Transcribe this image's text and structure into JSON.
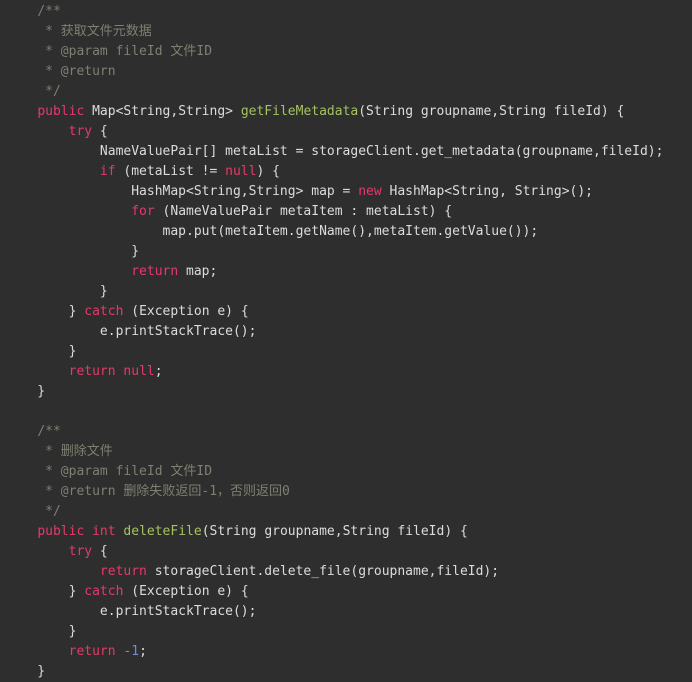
{
  "editor": {
    "background_color": "#2e2e2e",
    "default_text_color": "#dcdcdc",
    "keyword_color": "#e5396b",
    "method_color": "#a5c261",
    "comment_color": "#7f7f72",
    "number_color": "#6c8fd4",
    "language": "Java",
    "font_size_px": 13,
    "line_height_px": 20,
    "indent_spaces": 4
  },
  "code": {
    "lines": [
      {
        "index": 1,
        "tokens": [
          {
            "text": "    ",
            "type": "plain"
          },
          {
            "text": "/**",
            "type": "comment"
          }
        ]
      },
      {
        "index": 2,
        "tokens": [
          {
            "text": "     ",
            "type": "plain"
          },
          {
            "text": "* 获取文件元数据",
            "type": "comment"
          }
        ]
      },
      {
        "index": 3,
        "tokens": [
          {
            "text": "     ",
            "type": "plain"
          },
          {
            "text": "* @param fileId 文件ID",
            "type": "comment"
          }
        ]
      },
      {
        "index": 4,
        "tokens": [
          {
            "text": "     ",
            "type": "plain"
          },
          {
            "text": "* @return",
            "type": "comment"
          }
        ]
      },
      {
        "index": 5,
        "tokens": [
          {
            "text": "     ",
            "type": "plain"
          },
          {
            "text": "*/",
            "type": "comment"
          }
        ]
      },
      {
        "index": 6,
        "tokens": [
          {
            "text": "    ",
            "type": "plain"
          },
          {
            "text": "public",
            "type": "keyword"
          },
          {
            "text": " Map<String,String> ",
            "type": "plain"
          },
          {
            "text": "getFileMetadata",
            "type": "method"
          },
          {
            "text": "(String groupname,String fileId) {",
            "type": "plain"
          }
        ]
      },
      {
        "index": 7,
        "tokens": [
          {
            "text": "        ",
            "type": "plain"
          },
          {
            "text": "try",
            "type": "keyword"
          },
          {
            "text": " {",
            "type": "plain"
          }
        ]
      },
      {
        "index": 8,
        "tokens": [
          {
            "text": "            NameValuePair[] metaList = storageClient.get_metadata(groupname,fileId);",
            "type": "plain"
          }
        ]
      },
      {
        "index": 9,
        "tokens": [
          {
            "text": "            ",
            "type": "plain"
          },
          {
            "text": "if",
            "type": "keyword"
          },
          {
            "text": " (metaList != ",
            "type": "plain"
          },
          {
            "text": "null",
            "type": "keyword"
          },
          {
            "text": ") {",
            "type": "plain"
          }
        ]
      },
      {
        "index": 10,
        "tokens": [
          {
            "text": "                HashMap<String,String> map = ",
            "type": "plain"
          },
          {
            "text": "new",
            "type": "keyword"
          },
          {
            "text": " HashMap<String, String>();",
            "type": "plain"
          }
        ]
      },
      {
        "index": 11,
        "tokens": [
          {
            "text": "                ",
            "type": "plain"
          },
          {
            "text": "for",
            "type": "keyword"
          },
          {
            "text": " (NameValuePair metaItem : metaList) {",
            "type": "plain"
          }
        ]
      },
      {
        "index": 12,
        "tokens": [
          {
            "text": "                    map.put(metaItem.getName(),metaItem.getValue());",
            "type": "plain"
          }
        ]
      },
      {
        "index": 13,
        "tokens": [
          {
            "text": "                }",
            "type": "plain"
          }
        ]
      },
      {
        "index": 14,
        "tokens": [
          {
            "text": "                ",
            "type": "plain"
          },
          {
            "text": "return",
            "type": "keyword"
          },
          {
            "text": " map;",
            "type": "plain"
          }
        ]
      },
      {
        "index": 15,
        "tokens": [
          {
            "text": "            }",
            "type": "plain"
          }
        ]
      },
      {
        "index": 16,
        "tokens": [
          {
            "text": "        } ",
            "type": "plain"
          },
          {
            "text": "catch",
            "type": "keyword"
          },
          {
            "text": " (Exception e) {",
            "type": "plain"
          }
        ]
      },
      {
        "index": 17,
        "tokens": [
          {
            "text": "            e.printStackTrace();",
            "type": "plain"
          }
        ]
      },
      {
        "index": 18,
        "tokens": [
          {
            "text": "        }",
            "type": "plain"
          }
        ]
      },
      {
        "index": 19,
        "tokens": [
          {
            "text": "        ",
            "type": "plain"
          },
          {
            "text": "return",
            "type": "keyword"
          },
          {
            "text": " ",
            "type": "plain"
          },
          {
            "text": "null",
            "type": "keyword"
          },
          {
            "text": ";",
            "type": "plain"
          }
        ]
      },
      {
        "index": 20,
        "tokens": [
          {
            "text": "    }",
            "type": "plain"
          }
        ]
      },
      {
        "index": 21,
        "tokens": []
      },
      {
        "index": 22,
        "tokens": [
          {
            "text": "    ",
            "type": "plain"
          },
          {
            "text": "/**",
            "type": "comment"
          }
        ]
      },
      {
        "index": 23,
        "tokens": [
          {
            "text": "     ",
            "type": "plain"
          },
          {
            "text": "* 删除文件",
            "type": "comment"
          }
        ]
      },
      {
        "index": 24,
        "tokens": [
          {
            "text": "     ",
            "type": "plain"
          },
          {
            "text": "* @param fileId 文件ID",
            "type": "comment"
          }
        ]
      },
      {
        "index": 25,
        "tokens": [
          {
            "text": "     ",
            "type": "plain"
          },
          {
            "text": "* @return 删除失败返回-1，否则返回0",
            "type": "comment"
          }
        ]
      },
      {
        "index": 26,
        "tokens": [
          {
            "text": "     ",
            "type": "plain"
          },
          {
            "text": "*/",
            "type": "comment"
          }
        ]
      },
      {
        "index": 27,
        "tokens": [
          {
            "text": "    ",
            "type": "plain"
          },
          {
            "text": "public",
            "type": "keyword"
          },
          {
            "text": " ",
            "type": "plain"
          },
          {
            "text": "int",
            "type": "keyword"
          },
          {
            "text": " ",
            "type": "plain"
          },
          {
            "text": "deleteFile",
            "type": "method"
          },
          {
            "text": "(String groupname,String fileId) {",
            "type": "plain"
          }
        ]
      },
      {
        "index": 28,
        "tokens": [
          {
            "text": "        ",
            "type": "plain"
          },
          {
            "text": "try",
            "type": "keyword"
          },
          {
            "text": " {",
            "type": "plain"
          }
        ]
      },
      {
        "index": 29,
        "tokens": [
          {
            "text": "            ",
            "type": "plain"
          },
          {
            "text": "return",
            "type": "keyword"
          },
          {
            "text": " storageClient.delete_file(groupname,fileId);",
            "type": "plain"
          }
        ]
      },
      {
        "index": 30,
        "tokens": [
          {
            "text": "        } ",
            "type": "plain"
          },
          {
            "text": "catch",
            "type": "keyword"
          },
          {
            "text": " (Exception e) {",
            "type": "plain"
          }
        ]
      },
      {
        "index": 31,
        "tokens": [
          {
            "text": "            e.printStackTrace();",
            "type": "plain"
          }
        ]
      },
      {
        "index": 32,
        "tokens": [
          {
            "text": "        }",
            "type": "plain"
          }
        ]
      },
      {
        "index": 33,
        "tokens": [
          {
            "text": "        ",
            "type": "plain"
          },
          {
            "text": "return",
            "type": "keyword"
          },
          {
            "text": " ",
            "type": "plain"
          },
          {
            "text": "-1",
            "type": "number"
          },
          {
            "text": ";",
            "type": "plain"
          }
        ]
      },
      {
        "index": 34,
        "tokens": [
          {
            "text": "    }",
            "type": "plain"
          }
        ]
      }
    ]
  }
}
